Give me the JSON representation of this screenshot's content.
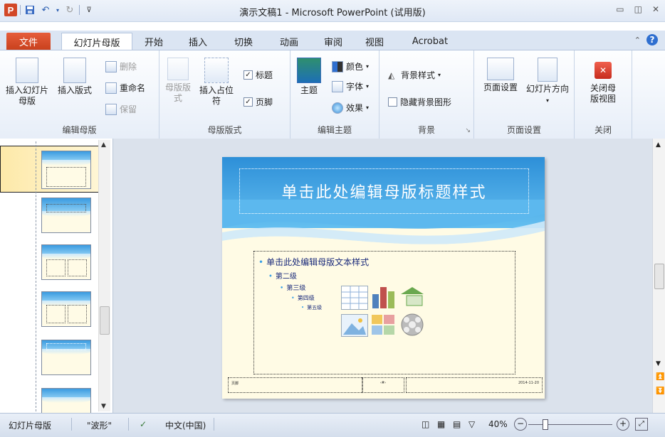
{
  "window": {
    "title": "演示文稿1 - Microsoft PowerPoint (试用版)"
  },
  "tabs": {
    "file": "文件",
    "items": [
      "幻灯片母版",
      "开始",
      "插入",
      "切换",
      "动画",
      "审阅",
      "视图",
      "Acrobat"
    ]
  },
  "ribbon": {
    "edit_master": {
      "label": "编辑母版",
      "insert_master": "插入幻灯片母版",
      "insert_layout": "插入版式",
      "delete": "删除",
      "rename": "重命名",
      "preserve": "保留"
    },
    "master_layout": {
      "label": "母版版式",
      "master_layout_btn": "母版版式",
      "insert_placeholder": "插入占位符",
      "title_chk": "标题",
      "footer_chk": "页脚"
    },
    "edit_theme": {
      "label": "编辑主题",
      "themes": "主题",
      "colors": "颜色",
      "fonts": "字体",
      "effects": "效果"
    },
    "background": {
      "label": "背景",
      "bg_styles": "背景样式",
      "hide_bg": "隐藏背景图形"
    },
    "page_setup": {
      "label": "页面设置",
      "page_setup_btn": "页面设置",
      "orientation": "幻灯片方向"
    },
    "close": {
      "label": "关闭",
      "close_btn": "关闭母版视图"
    }
  },
  "slide": {
    "title": "单击此处编辑母版标题样式",
    "levels": [
      "单击此处编辑母版文本样式",
      "第二级",
      "第三级",
      "第四级",
      "第五级"
    ],
    "footer_left": "页脚",
    "footer_mid": "‹#›",
    "footer_right": "2014-11-20"
  },
  "status": {
    "view": "幻灯片母版",
    "theme": "\"波形\"",
    "lang": "中文(中国)",
    "zoom": "40%"
  },
  "colors": {
    "accent": "#2d8fd8",
    "file_tab": "#d24726",
    "slide_bg": "#fffbe5"
  }
}
